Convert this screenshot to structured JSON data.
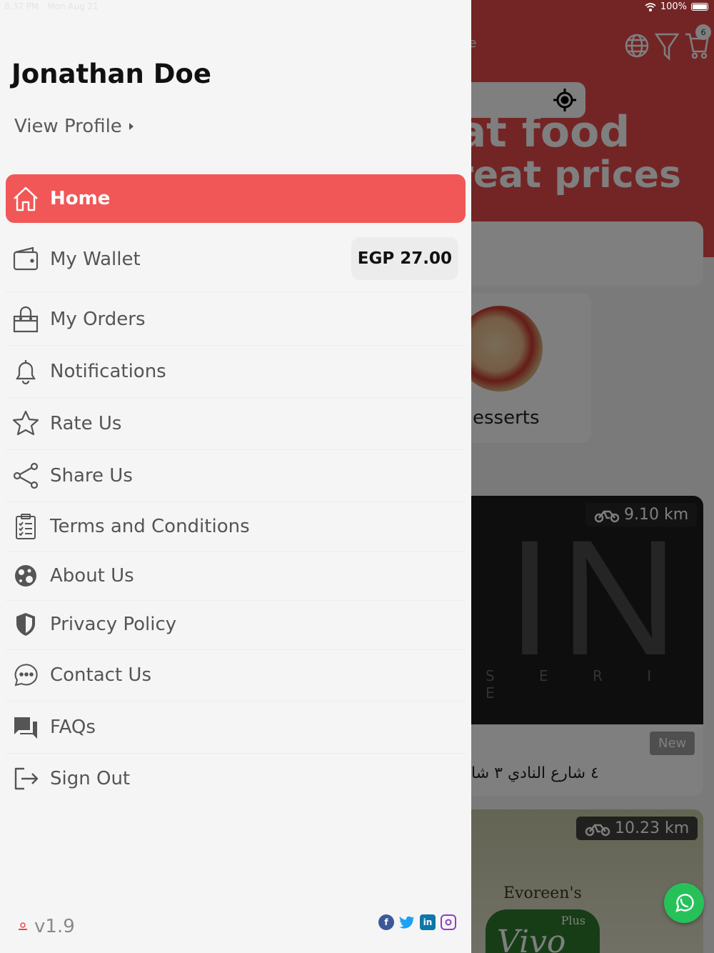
{
  "status_bar": {
    "time": "8:37 PM",
    "date": "Mon Aug 21",
    "battery": "100%"
  },
  "background": {
    "header_title_fragment": "ule",
    "cart_count": "6",
    "banner_line1": "eat food",
    "banner_line2": "great prices",
    "category_label": "esserts",
    "restaurant_letters": "IN",
    "restaurant_sub": "S E R I E",
    "distance_1": "9.10 km",
    "new_label": "New",
    "address": "٤ شارع النادي ٣ شا",
    "distance_2": "10.23 km",
    "brand_name": "Evoreen's",
    "brand_plus": "Plus",
    "brand_logo": "Vivo",
    "accent_color": "#e64a4a"
  },
  "drawer": {
    "user_name": "Jonathan Doe",
    "view_profile": "View Profile",
    "menu": {
      "home": "Home",
      "wallet": "My Wallet",
      "wallet_balance": "EGP 27.00",
      "orders": "My Orders",
      "notifications": "Notifications",
      "rate": "Rate Us",
      "share": "Share Us",
      "terms": "Terms and Conditions",
      "about": "About Us",
      "privacy": "Privacy Policy",
      "contact": "Contact Us",
      "faqs": "FAQs",
      "signout": "Sign Out"
    },
    "version": "v1.9",
    "socials": [
      "facebook-icon",
      "twitter-icon",
      "linkedin-icon",
      "instagram-icon"
    ],
    "active_color": "#f25757"
  }
}
